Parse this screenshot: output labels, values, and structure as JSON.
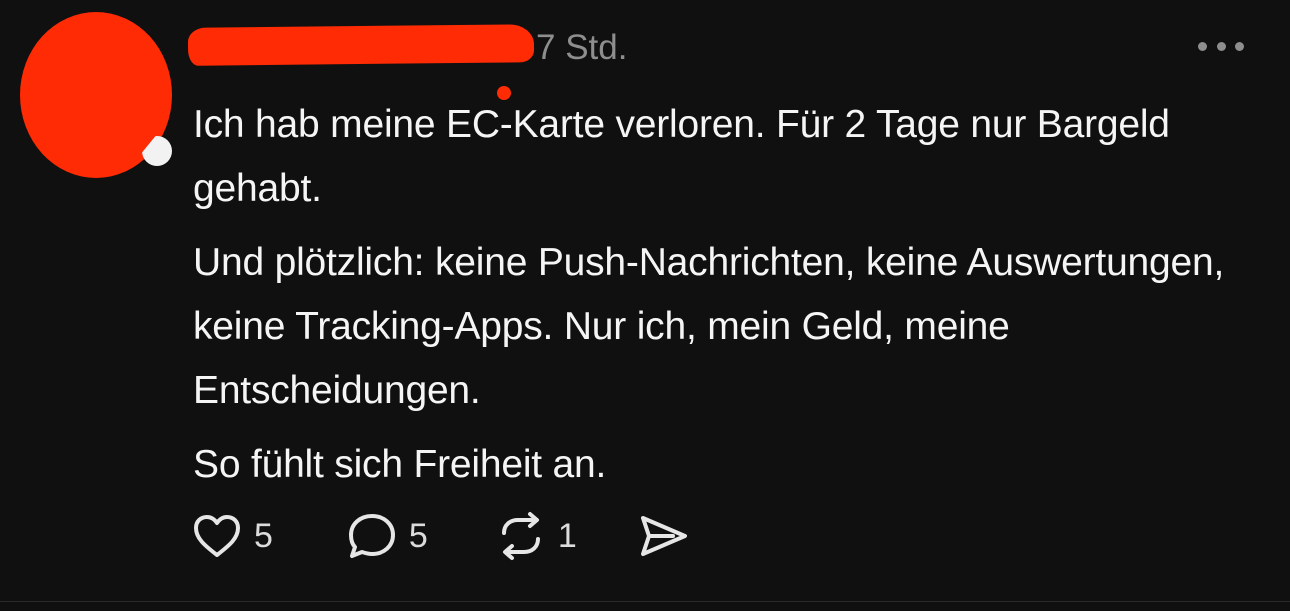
{
  "header": {
    "timestamp": "7 Std."
  },
  "body": {
    "paragraphs": [
      "Ich hab meine EC-Karte verloren. Für 2 Tage nur Bargeld gehabt.",
      "Und plötzlich: keine Push-Nachrichten, keine Auswertungen, keine Tracking-Apps. Nur ich, mein Geld, meine Entscheidungen.",
      "So fühlt sich Freiheit an."
    ]
  },
  "actions": {
    "likes": "5",
    "replies": "5",
    "reposts": "1"
  },
  "icons": {
    "like": "heart-icon",
    "reply": "speech-bubble-icon",
    "repost": "repost-icon",
    "share": "send-icon",
    "more": "more-horizontal-icon"
  },
  "colors": {
    "background": "#101010",
    "redaction": "#fe2b04",
    "text": "#f5f5f5",
    "muted": "#8e8e8e"
  }
}
